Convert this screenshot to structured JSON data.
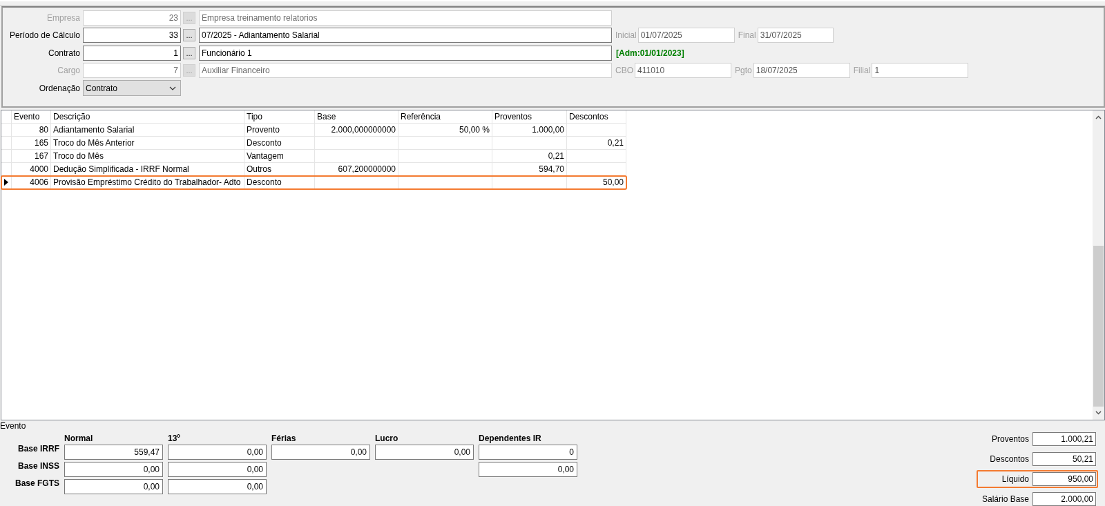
{
  "form": {
    "rows": [
      {
        "kind": "lookup",
        "label": "Empresa",
        "disabled": true,
        "code": "23",
        "button": "...",
        "description": "Empresa treinamento relatorios",
        "side": []
      },
      {
        "kind": "lookup",
        "label": "Período de Cálculo",
        "disabled": false,
        "code": "33",
        "button": "...",
        "description": "07/2025 - Adiantamento Salarial",
        "side": [
          {
            "kind": "field",
            "label": "Inicial",
            "value": "01/07/2025"
          },
          {
            "kind": "field",
            "label": "Final",
            "value": "31/07/2025"
          }
        ]
      },
      {
        "kind": "lookup",
        "label": "Contrato",
        "disabled": false,
        "code": "1",
        "button": "...",
        "description": "Funcionário 1",
        "side": [
          {
            "kind": "note",
            "value": "[Adm:01/01/2023]",
            "color": "#008000"
          }
        ]
      },
      {
        "kind": "lookup",
        "label": "Cargo",
        "disabled": true,
        "code": "7",
        "button": "...",
        "description": "Auxiliar Financeiro",
        "side": [
          {
            "kind": "field",
            "label": "CBO",
            "value": "411010"
          },
          {
            "kind": "field",
            "label": "Pgto",
            "value": "18/07/2025"
          },
          {
            "kind": "field",
            "label": "Filial",
            "value": "1"
          }
        ]
      },
      {
        "kind": "select",
        "label": "Ordenação",
        "disabled": false,
        "value": "Contrato",
        "side": []
      }
    ]
  },
  "grid": {
    "columns": [
      {
        "label": "Evento"
      },
      {
        "label": "Descrição"
      },
      {
        "label": "Tipo"
      },
      {
        "label": "Base"
      },
      {
        "label": "Referência"
      },
      {
        "label": "Proventos"
      },
      {
        "label": "Descontos"
      }
    ],
    "rows": [
      {
        "selected": false,
        "highlighted": false,
        "cells": [
          "80",
          "Adiantamento Salarial",
          "Provento",
          "2.000,000000000",
          "50,00 %",
          "1.000,00",
          null
        ]
      },
      {
        "selected": false,
        "highlighted": false,
        "cells": [
          "165",
          "Troco do Mês Anterior",
          "Desconto",
          null,
          null,
          null,
          "0,21"
        ]
      },
      {
        "selected": false,
        "highlighted": false,
        "cells": [
          "167",
          "Troco do Mês",
          "Vantagem",
          null,
          null,
          "0,21",
          null
        ]
      },
      {
        "selected": false,
        "highlighted": false,
        "cells": [
          "4000",
          "Dedução Simplificada - IRRF Normal",
          "Outros",
          "607,200000000",
          null,
          "594,70",
          null
        ]
      },
      {
        "selected": true,
        "highlighted": true,
        "cells": [
          "4006",
          "Provisão Empréstimo Crédito do Trabalhador- Adto",
          "Desconto",
          null,
          null,
          null,
          "50,00"
        ]
      }
    ]
  },
  "section_label": "Evento",
  "bases": {
    "row_labels": [
      "Base IRRF",
      "Base INSS",
      "Base FGTS"
    ],
    "columns": [
      {
        "label": "Normal",
        "values": [
          "559,47",
          "0,00",
          "0,00"
        ]
      },
      {
        "label": "13º",
        "values": [
          "0,00",
          "0,00",
          "0,00"
        ]
      },
      {
        "label": "Férias",
        "values": [
          "0,00"
        ]
      },
      {
        "label": "Lucro",
        "values": [
          "0,00"
        ]
      },
      {
        "label": "Dependentes IR",
        "values": [
          "0",
          "0,00"
        ]
      }
    ]
  },
  "totals": [
    {
      "label": "Proventos",
      "value": "1.000,21",
      "highlighted": false
    },
    {
      "label": "Descontos",
      "value": "50,21",
      "highlighted": false
    },
    {
      "label": "Líquido",
      "value": "950,00",
      "highlighted": true
    },
    {
      "label": "Salário Base",
      "value": "2.000,00",
      "highlighted": false
    }
  ]
}
